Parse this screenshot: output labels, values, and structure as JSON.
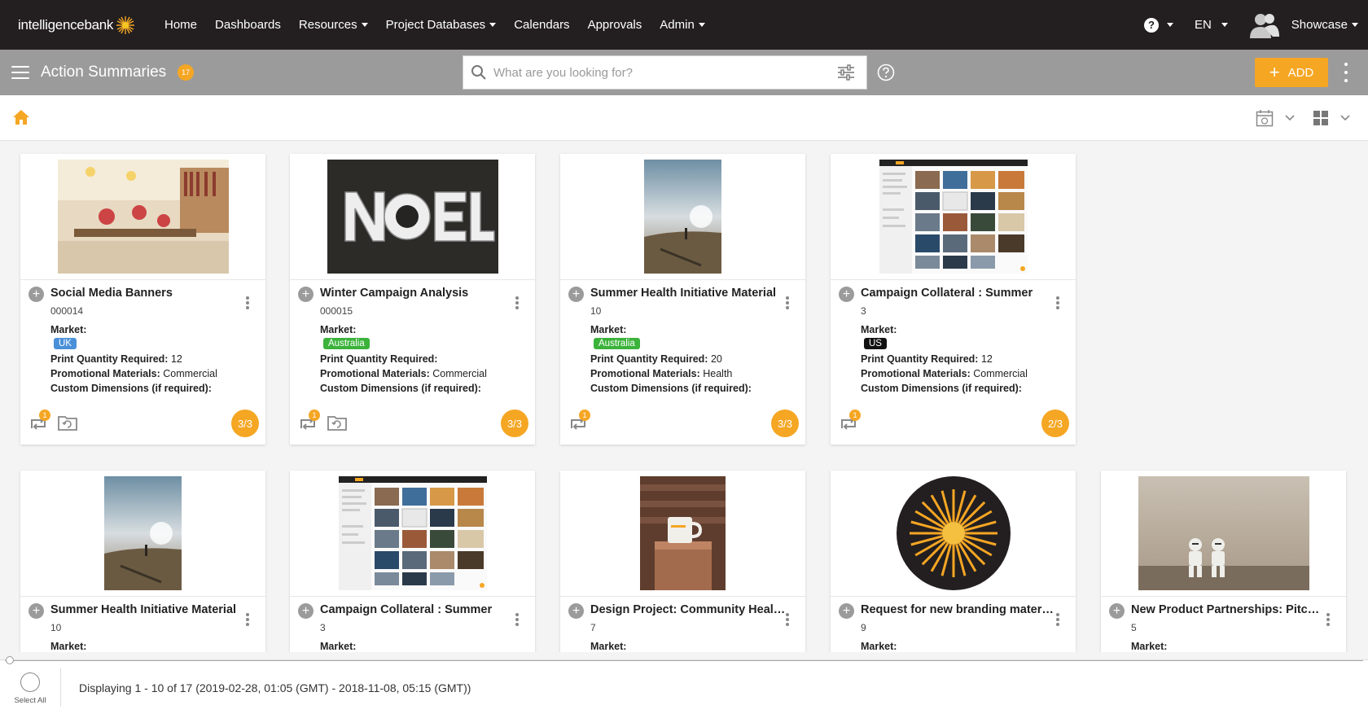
{
  "nav": {
    "logo_text": "intelligencebank",
    "items": [
      {
        "label": "Home",
        "dropdown": false
      },
      {
        "label": "Dashboards",
        "dropdown": false
      },
      {
        "label": "Resources",
        "dropdown": true
      },
      {
        "label": "Project Databases",
        "dropdown": true
      },
      {
        "label": "Calendars",
        "dropdown": false
      },
      {
        "label": "Approvals",
        "dropdown": false
      },
      {
        "label": "Admin",
        "dropdown": true
      }
    ],
    "help_label": "?",
    "language": "EN",
    "user": "Showcase"
  },
  "subbar": {
    "title": "Action Summaries",
    "count": "17",
    "search_placeholder": "What are you looking for?",
    "add_label": "ADD"
  },
  "cards": [
    {
      "title": "Social Media Banners",
      "number": "000014",
      "market_label": "Market:",
      "market": "UK",
      "market_color": "#4a90d9",
      "print_label": "Print Quantity Required:",
      "print_qty": "12",
      "promo_label": "Promotional Materials:",
      "promo": "Commercial",
      "custom_label": "Custom Dimensions (if required):",
      "retweet_count": "1",
      "has_folder": true,
      "progress": "3/3",
      "thumb": "office"
    },
    {
      "title": "Winter Campaign Analysis",
      "number": "000015",
      "market_label": "Market:",
      "market": "Australia",
      "market_color": "#3bb33b",
      "print_label": "Print Quantity Required:",
      "print_qty": "",
      "promo_label": "Promotional Materials:",
      "promo": "Commercial",
      "custom_label": "Custom Dimensions (if required):",
      "retweet_count": "1",
      "has_folder": true,
      "progress": "3/3",
      "thumb": "noel"
    },
    {
      "title": "Summer Health Initiative Material",
      "number": "10",
      "market_label": "Market:",
      "market": "Australia",
      "market_color": "#3bb33b",
      "print_label": "Print Quantity Required:",
      "print_qty": "20",
      "promo_label": "Promotional Materials:",
      "promo": "Health",
      "custom_label": "Custom Dimensions (if required):",
      "retweet_count": "1",
      "has_folder": false,
      "progress": "3/3",
      "thumb": "runner"
    },
    {
      "title": "Campaign Collateral : Summer",
      "number": "3",
      "market_label": "Market:",
      "market": "US",
      "market_color": "#111111",
      "print_label": "Print Quantity Required:",
      "print_qty": "12",
      "promo_label": "Promotional Materials:",
      "promo": "Commercial",
      "custom_label": "Custom Dimensions (if required):",
      "retweet_count": "1",
      "has_folder": false,
      "progress": "2/3",
      "thumb": "screenshot"
    },
    {
      "title": "Summer Health Initiative Material",
      "number": "10",
      "market_label": "Market:",
      "thumb": "runner"
    },
    {
      "title": "Campaign Collateral : Summer",
      "number": "3",
      "market_label": "Market:",
      "thumb": "screenshot"
    },
    {
      "title": "Design Project: Community Healt...",
      "number": "7",
      "market_label": "Market:",
      "thumb": "mug"
    },
    {
      "title": "Request for new branding materials",
      "number": "9",
      "market_label": "Market:",
      "thumb": "sun"
    },
    {
      "title": "New Product Partnerships: Pitchi...",
      "number": "5",
      "market_label": "Market:",
      "thumb": "troopers"
    }
  ],
  "footer": {
    "select_all": "Select All",
    "display_text": "Displaying 1 - 10 of 17 (2019-02-28, 01:05 (GMT) - 2018-11-08, 05:15 (GMT))"
  },
  "colors": {
    "accent": "#f5a623",
    "nav_bg": "#231f20",
    "subbar_bg": "#9b9b9b"
  }
}
